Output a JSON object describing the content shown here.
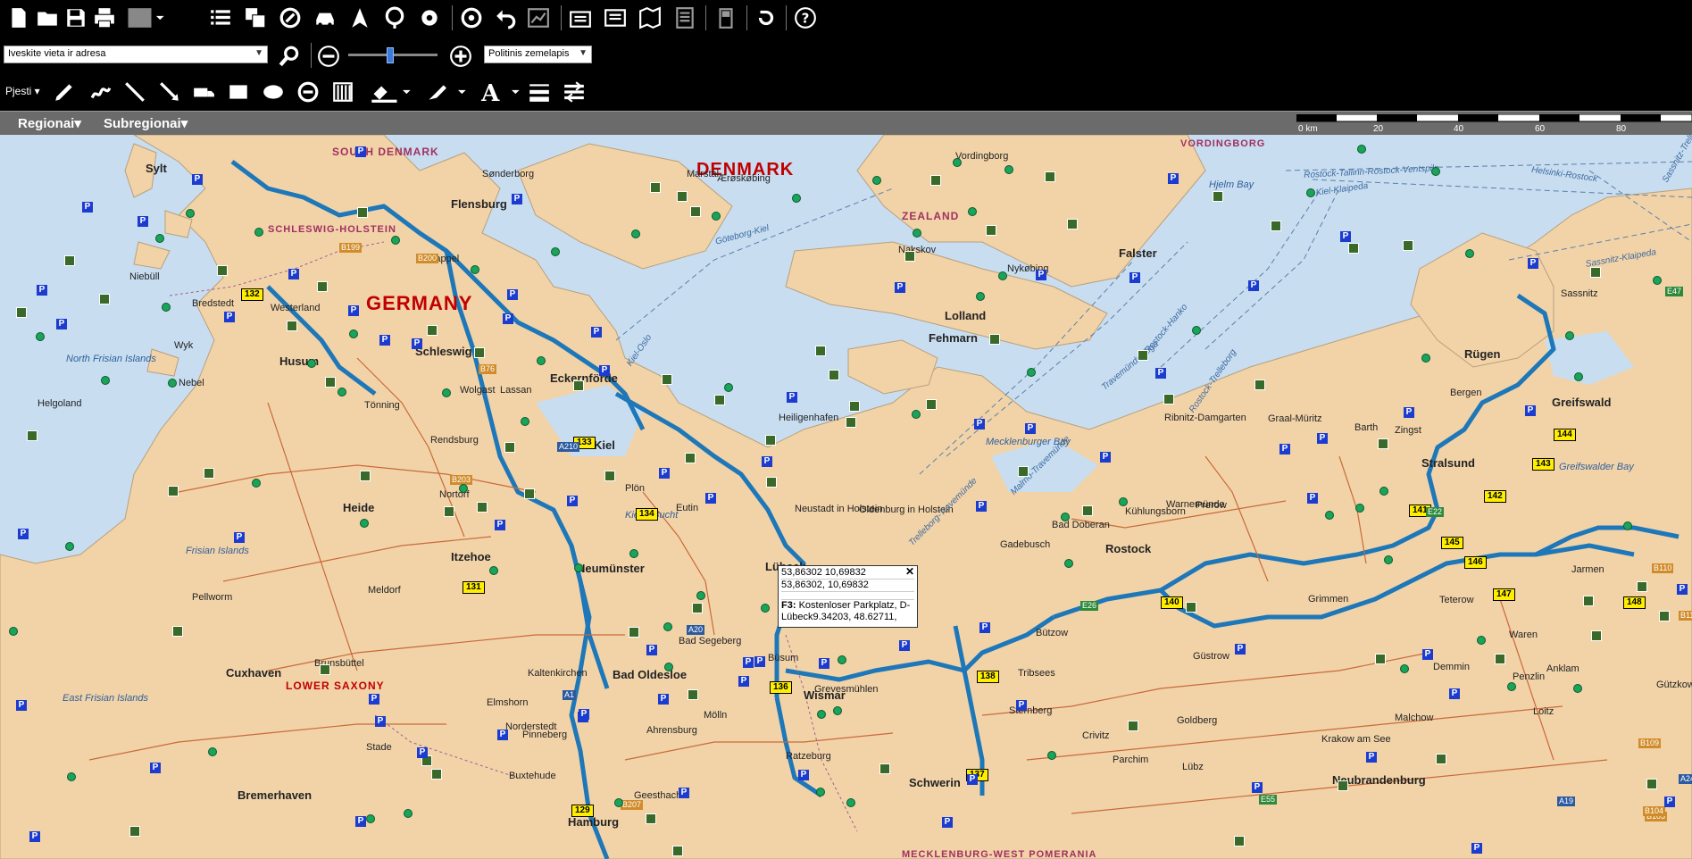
{
  "toolbar": {
    "icons": [
      "new-document-icon",
      "open-folder-icon",
      "save-icon",
      "print-icon",
      "map-layer-icon",
      "list-icon",
      "copy-windows-icon",
      "route-icon",
      "car-icon",
      "navigate-arrow-icon",
      "map-pin-icon",
      "settings-gear-icon",
      "steering-wheel-icon",
      "undo-icon",
      "chart-icon",
      "import-icon",
      "export-icon",
      "map-book-icon",
      "document-list-icon",
      "gps-device-icon",
      "redo-icon",
      "help-icon"
    ],
    "address_placeholder": "Iveskite vieta ir adresa",
    "map_type": "Politinis zemelapis",
    "draw_label": "Pjesti"
  },
  "regions": {
    "regional": "Regionai",
    "subregional": "Subregionai"
  },
  "scale": {
    "labels": [
      "0 km",
      "20",
      "40",
      "60",
      "80"
    ]
  },
  "popup": {
    "line1": "53,86302 10,69832",
    "line2": "53,86302, 10,69832",
    "label": "F3:",
    "text": "Kostenloser Parkplatz, D-Lübeck9.34203, 48.62711,"
  },
  "map": {
    "country_labels": [
      "DENMARK",
      "GERMANY",
      "SOUTH DENMARK",
      "VORDINGBORG",
      "SCHLESWIG-HOLSTEIN",
      "ZEALAND",
      "MECKLENBURG-WEST POMERANIA",
      "LOWER SAXONY"
    ],
    "cities": [
      "Flensburg",
      "Schleswig",
      "Kiel",
      "Neumünster",
      "Itzehoe",
      "Heide",
      "Hamburg",
      "Lübeck",
      "Rostock",
      "Stralsund",
      "Wismar",
      "Schwerin",
      "Cuxhaven",
      "Bremerhaven",
      "Neubrandenburg",
      "Greifswald",
      "Eckernförde",
      "Husum",
      "Sylt",
      "Fehmarn",
      "Lolland",
      "Falster",
      "Rügen",
      "Bad Oldesloe",
      "Ahrensburg",
      "Pinneberg",
      "Elmshorn",
      "Heiligenhafen",
      "Grimmen",
      "Anklam",
      "Ribnitz-Damgarten",
      "Bergen",
      "Sassnitz",
      "Helgoland",
      "Sønderborg",
      "Nakskov",
      "Nykøbing",
      "Vordingborg",
      "Marstal",
      "Ærøskøbing",
      "Kappel",
      "Güstrow",
      "Teterow",
      "Demmin",
      "Bützow",
      "Stade",
      "Buxtehude",
      "Geesthacht",
      "Ratzeburg",
      "Mölln",
      "Plön",
      "Eutin",
      "Neustadt in Holstein",
      "Oldenburg in Holstein",
      "Bad Segeberg",
      "Norderstedt",
      "Kaltenkirchen",
      "Rendsburg",
      "Nortorf",
      "Brunsbüttel",
      "Meldorf",
      "Tönning",
      "Niebüll",
      "Bredstedt",
      "Westerland",
      "Wyk",
      "Nebel",
      "Pellworm",
      "Büsum",
      "Grevesmühlen",
      "Gadebusch",
      "Bad Doberan",
      "Kühlungsborn",
      "Warnemünde",
      "Graal-Müritz",
      "Barth",
      "Zingst",
      "Prerow",
      "Tribsees",
      "Sternberg",
      "Crivitz",
      "Parchim",
      "Lübz",
      "Goldberg",
      "Krakow am See",
      "Malchow",
      "Waren",
      "Penzlin",
      "Loitz",
      "Jarmen",
      "Gützkow",
      "Wolgast",
      "Lassan"
    ],
    "seas": [
      "Mecklenburger Bay",
      "Kieler Bucht",
      "Hjelm Bay",
      "Greifswalder Bay",
      "Frisian Islands",
      "East Frisian Islands",
      "North Frisian Islands"
    ],
    "ferries": [
      "Göteborg-Kiel",
      "Kiel-Oslo",
      "Trelleborg-Travemünde",
      "Malmö-Travemünde",
      "Rostock-Trelleborg",
      "Rostock-Hanko",
      "Rostock-Tallinn-Rostock-Ventspils",
      "Helsinki-Rostock",
      "Kiel-Klaipeda",
      "Sassnitz-Klaipeda",
      "Sassnitz-Trelleborg",
      "Travemünde-Riga"
    ],
    "route_shields": [
      "131",
      "132",
      "133",
      "134",
      "136",
      "137",
      "138",
      "140",
      "141",
      "142",
      "143",
      "144",
      "145",
      "146",
      "147",
      "148",
      "129"
    ],
    "road_labels": [
      "B199",
      "B200",
      "B76",
      "A210",
      "B203",
      "A20",
      "A1",
      "A24",
      "B105",
      "B104",
      "B110",
      "B111",
      "B109",
      "B207",
      "E22",
      "E26",
      "E55",
      "A19",
      "E47"
    ]
  },
  "colors": {
    "land": "#f2d3a8",
    "water": "#c8ddf0",
    "route": "#1d77b8",
    "toolbar": "#000000",
    "region_bar": "#6b6b6b"
  }
}
